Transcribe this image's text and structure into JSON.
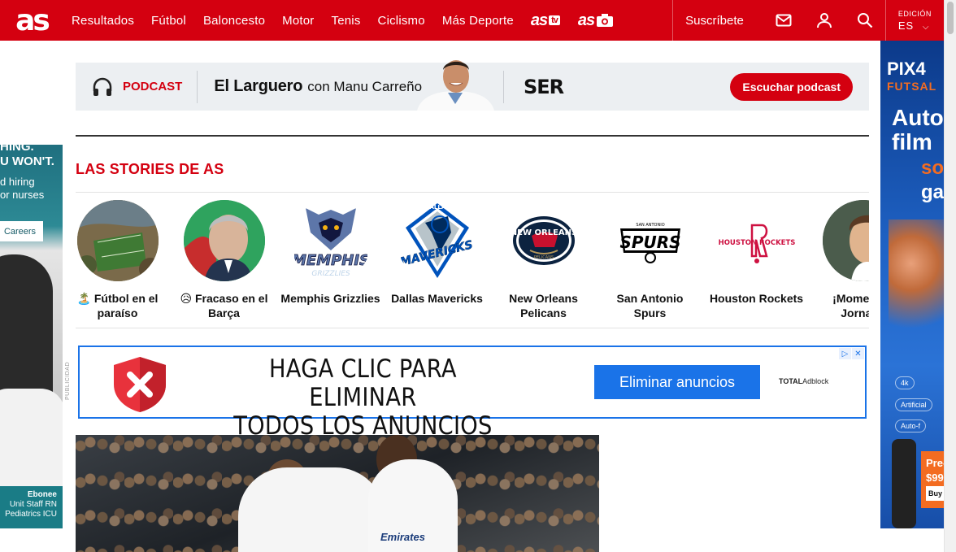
{
  "header": {
    "logo": "as",
    "nav": [
      "Resultados",
      "Fútbol",
      "Baloncesto",
      "Motor",
      "Tenis",
      "Ciclismo",
      "Más Deporte"
    ],
    "brand_tv": "as",
    "brand_tv_badge": "tv",
    "brand_photo": "as",
    "subscribe": "Suscríbete",
    "edition_label": "EDICIÓN",
    "edition_value": "ES"
  },
  "podcast": {
    "label": "PODCAST",
    "title": "El Larguero",
    "subtitle": "con Manu Carreño",
    "network": "SER",
    "button": "Escuchar podcast"
  },
  "stories": {
    "title": "LAS STORIES DE AS",
    "items": [
      {
        "name": "🏝️ Fútbol en el paraíso"
      },
      {
        "name": "😥 Fracaso en el Barça"
      },
      {
        "name": "Memphis Grizzlies"
      },
      {
        "name": "Dallas Mavericks"
      },
      {
        "name": "New Orleans Pelicans"
      },
      {
        "name": "San Antonio Spurs"
      },
      {
        "name": "Houston Rockets"
      },
      {
        "name": "¡Momentos Jornada"
      }
    ]
  },
  "ad": {
    "headline_1": "HAGA CLIC PARA ELIMINAR",
    "headline_2": "TODOS LOS ANUNCIOS",
    "button": "Eliminar anuncios",
    "brand_bold": "TOTAL",
    "brand_light": "Adblock",
    "publicidad": "PUBLICIDAD"
  },
  "left_ad": {
    "line1": "HING.",
    "line2": "U WON'T.",
    "line3": "d hiring",
    "line4": "or nurses",
    "cta": "Careers",
    "person": "Ebonee",
    "role1": "Unit Staff RN",
    "role2": "Pediatrics ICU"
  },
  "right_ad": {
    "brand": "PIX4",
    "sub": "FUTSAL",
    "line1": "Autor",
    "line2": "film",
    "line3": "soc",
    "line4": "ga",
    "feat1": "4k",
    "feat2": "Artificial",
    "feat3": "Auto-f",
    "promo1": "Pre-",
    "promo2": "$99",
    "promo3": "Buy"
  },
  "hero": {
    "shirt_text": "Emirates"
  },
  "colors": {
    "accent": "#d40010",
    "ad_blue": "#1a73e8"
  }
}
